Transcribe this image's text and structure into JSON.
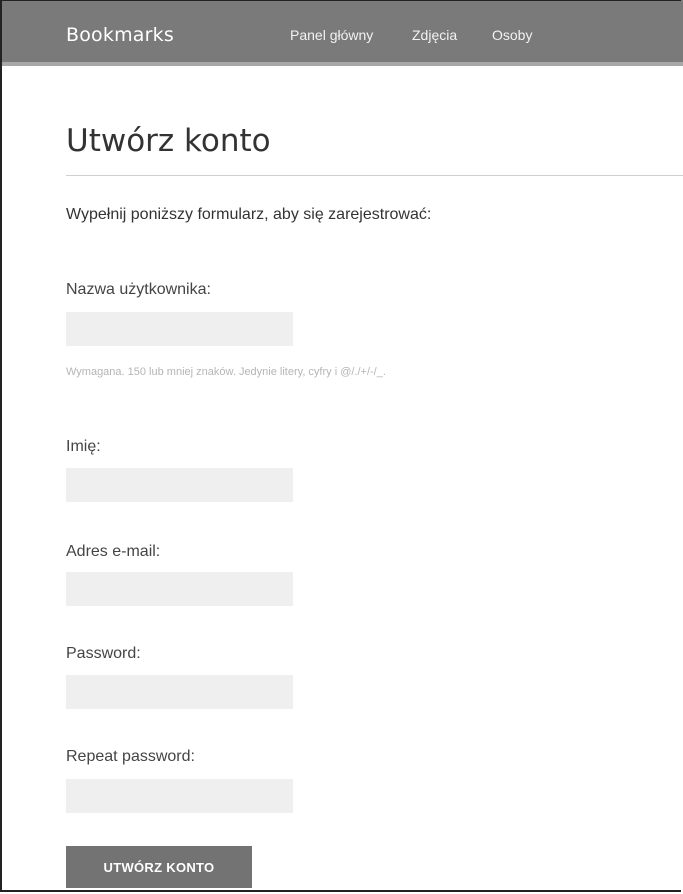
{
  "header": {
    "brand": "Bookmarks",
    "nav": [
      {
        "label": "Panel główny"
      },
      {
        "label": "Zdjęcia"
      },
      {
        "label": "Osoby"
      }
    ]
  },
  "main": {
    "title": "Utwórz konto",
    "intro": "Wypełnij poniższy formularz, aby się zarejestrować:",
    "fields": [
      {
        "label": "Nazwa użytkownika:",
        "value": ""
      },
      {
        "label": "Imię:",
        "value": ""
      },
      {
        "label": "Adres e-mail:",
        "value": ""
      },
      {
        "label": "Password:",
        "value": ""
      },
      {
        "label": "Repeat password:",
        "value": ""
      }
    ],
    "username_help": "Wymagana. 150 lub mniej znaków. Jedynie litery, cyfry i @/./+/-/_.",
    "submit_label": "UTWÓRZ KONTO"
  }
}
